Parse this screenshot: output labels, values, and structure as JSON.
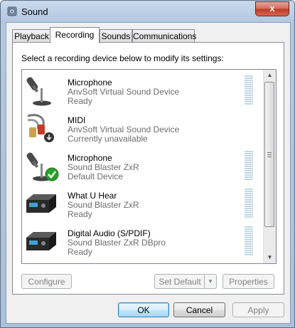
{
  "window": {
    "title": "Sound",
    "close_glyph": "x"
  },
  "tabs": [
    {
      "label": "Playback"
    },
    {
      "label": "Recording",
      "active": true
    },
    {
      "label": "Sounds"
    },
    {
      "label": "Communications"
    }
  ],
  "instruction": "Select a recording device below to modify its settings:",
  "devices": [
    {
      "name": "Microphone",
      "driver": "AnvSoft Virtual Sound Device",
      "status": "Ready",
      "icon": "microphone-icon"
    },
    {
      "name": "MIDI",
      "driver": "AnvSoft Virtual Sound Device",
      "status": "Currently unavailable",
      "icon": "midi-cable-icon"
    },
    {
      "name": "Microphone",
      "driver": "Sound Blaster ZxR",
      "status": "Default Device",
      "icon": "microphone-icon"
    },
    {
      "name": "What U Hear",
      "driver": "Sound Blaster ZxR",
      "status": "Ready",
      "icon": "sound-card-icon"
    },
    {
      "name": "Digital Audio (S/PDIF)",
      "driver": "Sound Blaster ZxR DBpro",
      "status": "Ready",
      "icon": "sound-card-icon"
    }
  ],
  "buttons": {
    "configure": "Configure",
    "set_default": "Set Default",
    "properties": "Properties",
    "ok": "OK",
    "cancel": "Cancel",
    "apply": "Apply"
  },
  "colors": {
    "titlebar": "#b9cde5",
    "close": "#c1392a",
    "check": "#2aa02a",
    "meter": "#c5d9e3"
  }
}
